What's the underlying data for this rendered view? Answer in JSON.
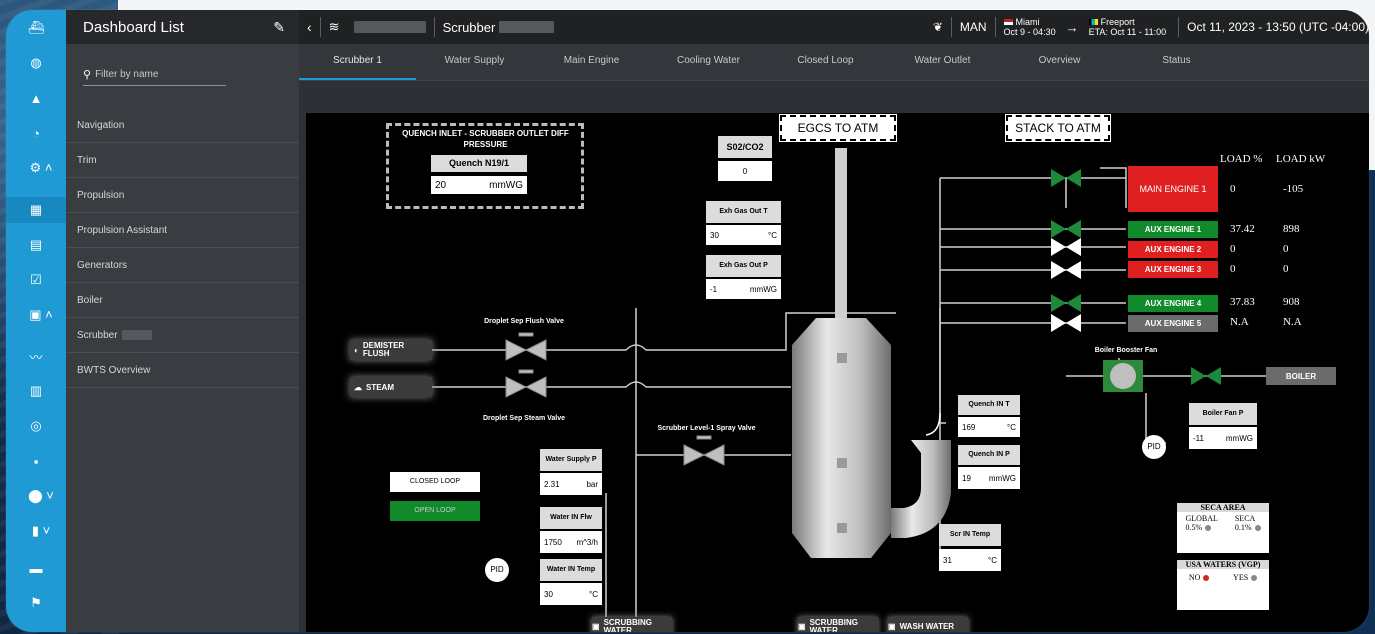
{
  "sidebar": {
    "title": "Dashboard List",
    "filter_placeholder": "Filter by name",
    "items": [
      {
        "label": "Navigation"
      },
      {
        "label": "Trim"
      },
      {
        "label": "Propulsion"
      },
      {
        "label": "Propulsion Assistant"
      },
      {
        "label": "Generators"
      },
      {
        "label": "Boiler"
      },
      {
        "label": "Scrubber"
      },
      {
        "label": "BWTS Overview"
      }
    ]
  },
  "topbar": {
    "title": "Scrubber",
    "mode": "MAN",
    "from_port": "Miami",
    "from_date": "Oct 9 - 04:30",
    "to_port": "Freeport",
    "eta": "ETA: Oct 11 - 11:00",
    "datetime": "Oct 11, 2023 - 13:50 (UTC -04:00)"
  },
  "tabs": [
    {
      "label": "Scrubber 1",
      "active": true
    },
    {
      "label": "Water Supply"
    },
    {
      "label": "Main Engine"
    },
    {
      "label": "Cooling Water"
    },
    {
      "label": "Closed Loop"
    },
    {
      "label": "Water Outlet"
    },
    {
      "label": "Overview"
    },
    {
      "label": "Status"
    }
  ],
  "diagram": {
    "quench_title": "QUENCH INLET - SCRUBBER OUTLET DIFF PRESSURE",
    "quench_label": "Quench N19/1",
    "quench_value": "20",
    "quench_unit": "mmWG",
    "so2_label": "S02/CO2",
    "so2_value": "0",
    "exh_t_label": "Exh Gas Out T",
    "exh_t_value": "30",
    "exh_t_unit": "°C",
    "exh_p_label": "Exh Gas Out P",
    "exh_p_value": "-1",
    "exh_p_unit": "mmWG",
    "egcs": "EGCS TO ATM",
    "stack": "STACK TO ATM",
    "load_pct_hdr": "LOAD %",
    "load_kw_hdr": "LOAD kW",
    "engines": [
      {
        "name": "MAIN ENGINE 1",
        "pct": "0",
        "kw": "-105",
        "color": "#e02020"
      },
      {
        "name": "AUX ENGINE 1",
        "pct": "37.42",
        "kw": "898",
        "color": "#108a2a"
      },
      {
        "name": "AUX ENGINE 2",
        "pct": "0",
        "kw": "0",
        "color": "#e02020"
      },
      {
        "name": "AUX ENGINE 3",
        "pct": "0",
        "kw": "0",
        "color": "#e02020"
      },
      {
        "name": "AUX ENGINE 4",
        "pct": "37.83",
        "kw": "908",
        "color": "#108a2a"
      },
      {
        "name": "AUX ENGINE 5",
        "pct": "N.A",
        "kw": "N.A",
        "color": "#6b6b6b"
      }
    ],
    "demister": "DEMISTER FLUSH",
    "steam": "STEAM",
    "flush_valve": "Droplet Sep Flush Valve",
    "steam_valve": "Droplet Sep Steam Valve",
    "spray_valve": "Scrubber Level-1 Spray Valve",
    "boiler_fan": "Boiler Booster Fan",
    "boiler": "BOILER",
    "boiler_fan_p_label": "Boiler Fan P",
    "boiler_fan_p_value": "-11",
    "boiler_fan_p_unit": "mmWG",
    "pid": "PID",
    "quench_t_label": "Quench IN T",
    "quench_t_value": "169",
    "quench_t_unit": "°C",
    "quench_p_label": "Quench IN P",
    "quench_p_value": "19",
    "quench_p_unit": "mmWG",
    "scr_t_label": "Scr IN Temp",
    "scr_t_value": "31",
    "scr_t_unit": "°C",
    "ws_p_label": "Water Supply P",
    "ws_p_value": "2.31",
    "ws_p_unit": "bar",
    "win_flw_label": "Water IN Flw",
    "win_flw_value": "1750",
    "win_flw_unit": "m^3/h",
    "win_t_label": "Water IN Temp",
    "win_t_value": "30",
    "win_t_unit": "°C",
    "closed_loop": "CLOSED LOOP",
    "open_loop": "OPEN LOOP",
    "seca_title": "SECA AREA",
    "global_label": "GLOBAL",
    "global_value": "0.5%",
    "seca_label": "SECA",
    "seca_value": "0.1%",
    "usa_title": "USA WATERS (VGP)",
    "no_label": "NO",
    "yes_label": "YES",
    "scrub_water_1": "SCRUBBING WATER",
    "scrub_water_2": "SCRUBBING WATER",
    "wash_water": "WASH WATER"
  },
  "colors": {
    "accent": "#1f9ad4",
    "running": "#108a2a",
    "stopped": "#e02020",
    "na": "#6b6b6b"
  },
  "icons": [
    "ship-icon",
    "globe-icon",
    "bell-icon",
    "gauge-icon",
    "engine-icon",
    "dashboard-icon",
    "table-icon",
    "check-icon",
    "image-icon",
    "trend-icon",
    "book-icon",
    "target-icon",
    "box-icon",
    "location-icon",
    "bar-chart-icon",
    "document-icon",
    "flag-icon"
  ]
}
